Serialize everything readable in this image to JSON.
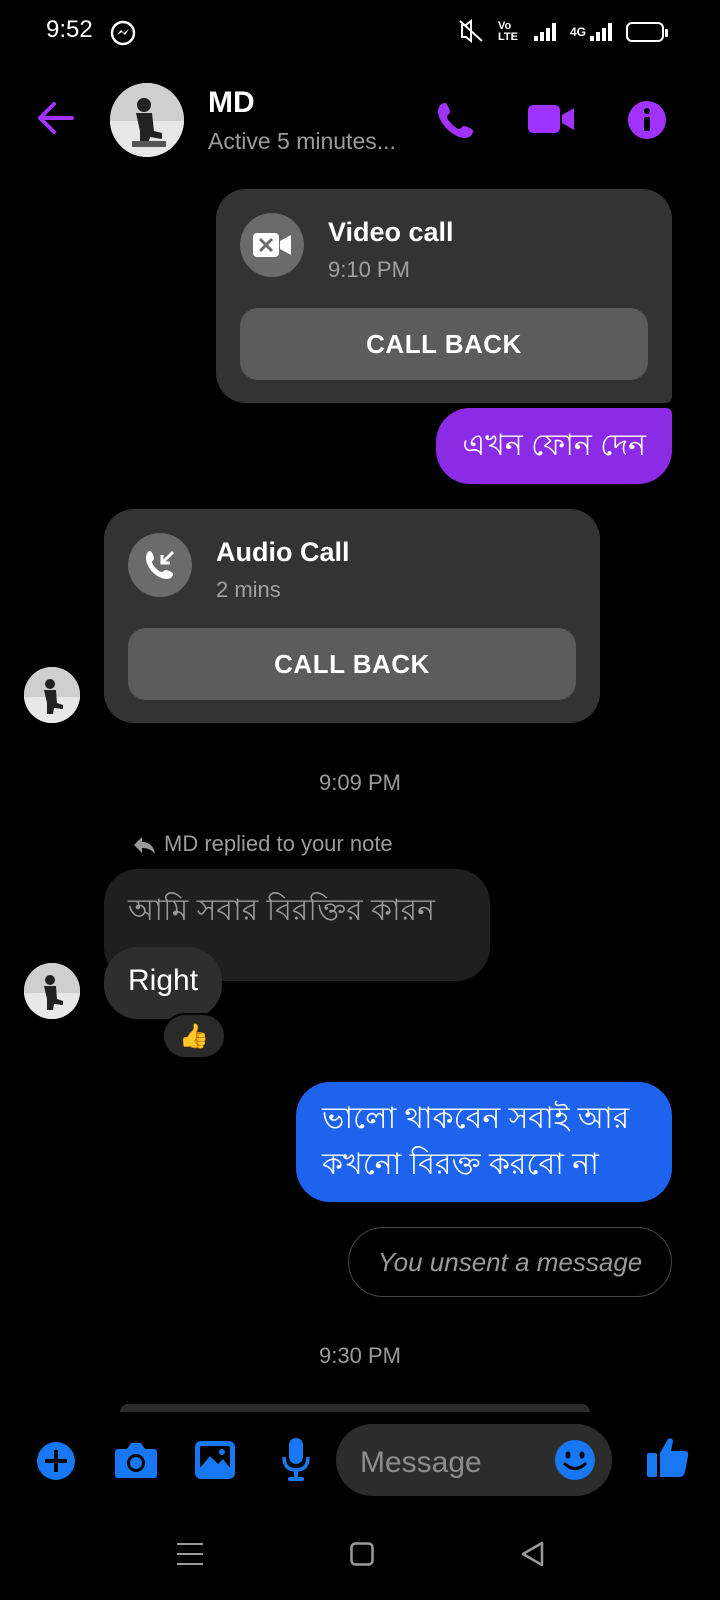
{
  "status_bar": {
    "time": "9:52",
    "network": "4G",
    "volte": "Vo LTE"
  },
  "header": {
    "name": "MD",
    "status": "Active 5 minutes..."
  },
  "messages": {
    "video_call": {
      "title": "Video call",
      "time": "9:10 PM",
      "action": "CALL BACK"
    },
    "sent_1": "এখন ফোন দেন",
    "audio_call": {
      "title": "Audio Call",
      "duration": "2 mins",
      "action": "CALL BACK"
    },
    "timestamp_1": "9:09 PM",
    "reply_note_label": "MD replied to your note",
    "note_text": "আমি সবার বিরক্তির কারন",
    "received_right": "Right",
    "reaction": "👍",
    "sent_2_line1": "ভালো থাকবেন সবাই আর",
    "sent_2_line2": "কখনো বিরক্ত করবো না",
    "unsent": "You unsent a message",
    "timestamp_2": "9:30 PM"
  },
  "composer": {
    "placeholder": "Message"
  },
  "colors": {
    "accent_purple": "#a033ff",
    "bubble_purple": "#8c2be6",
    "bubble_blue": "#1e63ee",
    "composer_blue": "#1877f2"
  }
}
